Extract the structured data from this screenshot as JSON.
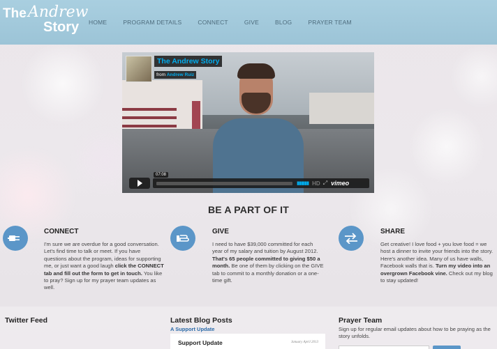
{
  "site": {
    "logo_the": "The",
    "logo_andrew": "Andrew",
    "logo_story": "Story"
  },
  "nav": {
    "items": [
      {
        "label": "HOME"
      },
      {
        "label": "PROGRAM DETAILS"
      },
      {
        "label": "CONNECT"
      },
      {
        "label": "GIVE"
      },
      {
        "label": "BLOG"
      },
      {
        "label": "PRAYER TEAM"
      }
    ]
  },
  "video": {
    "title": "The Andrew Story",
    "from_prefix": "from",
    "author": "Andrew Ruiz",
    "timestamp": "07:08",
    "hd_label": "HD",
    "brand": "vimeo",
    "progress": 0
  },
  "section": {
    "heading": "BE A PART OF IT"
  },
  "columns": [
    {
      "icon": "plug-icon",
      "title": "CONNECT",
      "text_1": "I'm sure we are overdue for a good conversation. Let's find time to talk or meet. If you have questions about the program, ideas for supporting me, or just want a good laugh ",
      "bold_1": "click the CONNECT tab and fill out the form to get in touch.",
      "text_2": " You like to pray? Sign up for my prayer team updates as well."
    },
    {
      "icon": "hand-icon",
      "title": "GIVE",
      "text_1": "I need to have $39,000 committed for each year of my salary and tuition by August 2012. ",
      "bold_1": "That's 65 people committed to giving $50 a month.",
      "text_2": " Be one of them by clicking on the GIVE tab to commit to a monthly donation or a one-time gift."
    },
    {
      "icon": "share-arrows-icon",
      "title": "SHARE",
      "text_1": "Get creative! I love food + you love food = we host a dinner to invite your friends into the story. Here's another idea. Many of us have walls, Facebook walls that is. ",
      "bold_1": "Turn my video into an overgrown Facebook vine.",
      "text_2": " Check out my blog to stay updated!"
    }
  ],
  "bottom": {
    "twitter_title": "Twitter Feed",
    "blog_title": "Latest Blog Posts",
    "blog_link": "A Support Update",
    "blog_card_title": "Support Update",
    "blog_card_date": "January April 2013",
    "prayer_title": "Prayer Team",
    "prayer_text": "Sign up for regular email updates about how to be praying as the story unfolds."
  },
  "colors": {
    "header": "#a9cfe0",
    "icon_circle": "#5b96c8",
    "vimeo_blue": "#00adef",
    "link": "#2a6aa8"
  }
}
